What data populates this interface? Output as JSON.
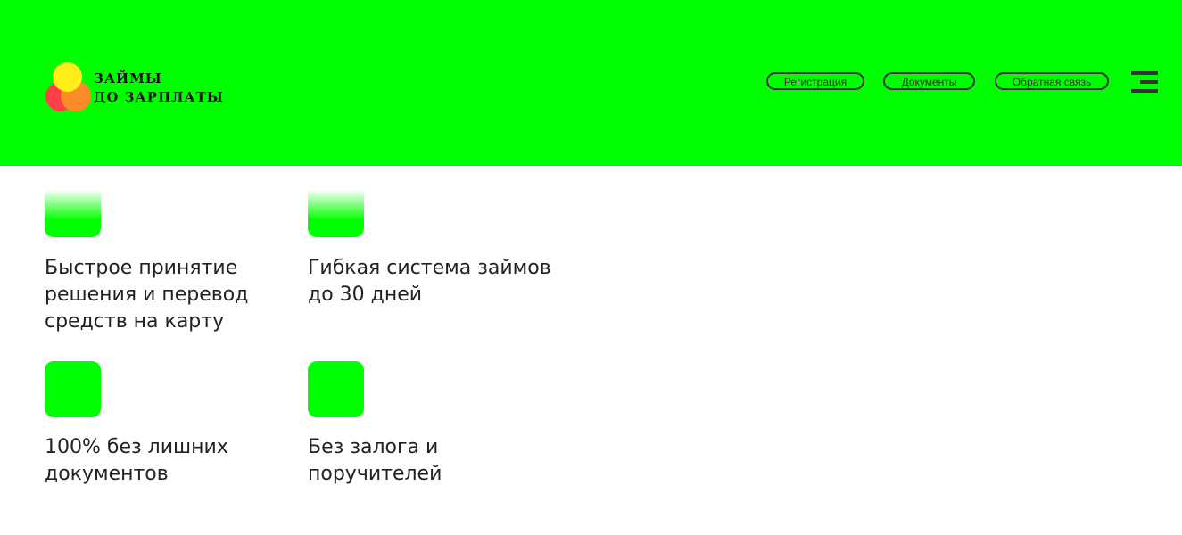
{
  "brand": {
    "line1": "ЗАЙМЫ",
    "line2": "ДО ЗАРПЛАТЫ"
  },
  "nav": {
    "items": [
      {
        "label": "Регистрация"
      },
      {
        "label": "Документы"
      },
      {
        "label": "Обратная связь"
      }
    ]
  },
  "features": [
    {
      "text": "Быстрое принятие решения и перевод средств на карту"
    },
    {
      "text": "Гибкая система займов до 30 дней"
    },
    {
      "text": "100% без лишних документов"
    },
    {
      "text": "Без залога и поручителей"
    }
  ],
  "colors": {
    "accent": "#00ff00",
    "text": "#222222",
    "logo_red": "#ff3f4a",
    "logo_orange": "#ff8a2a",
    "logo_yellow": "#ffee1a"
  },
  "icons": {
    "menu": "hamburger-menu-icon",
    "logo": "logo-circles-icon"
  }
}
